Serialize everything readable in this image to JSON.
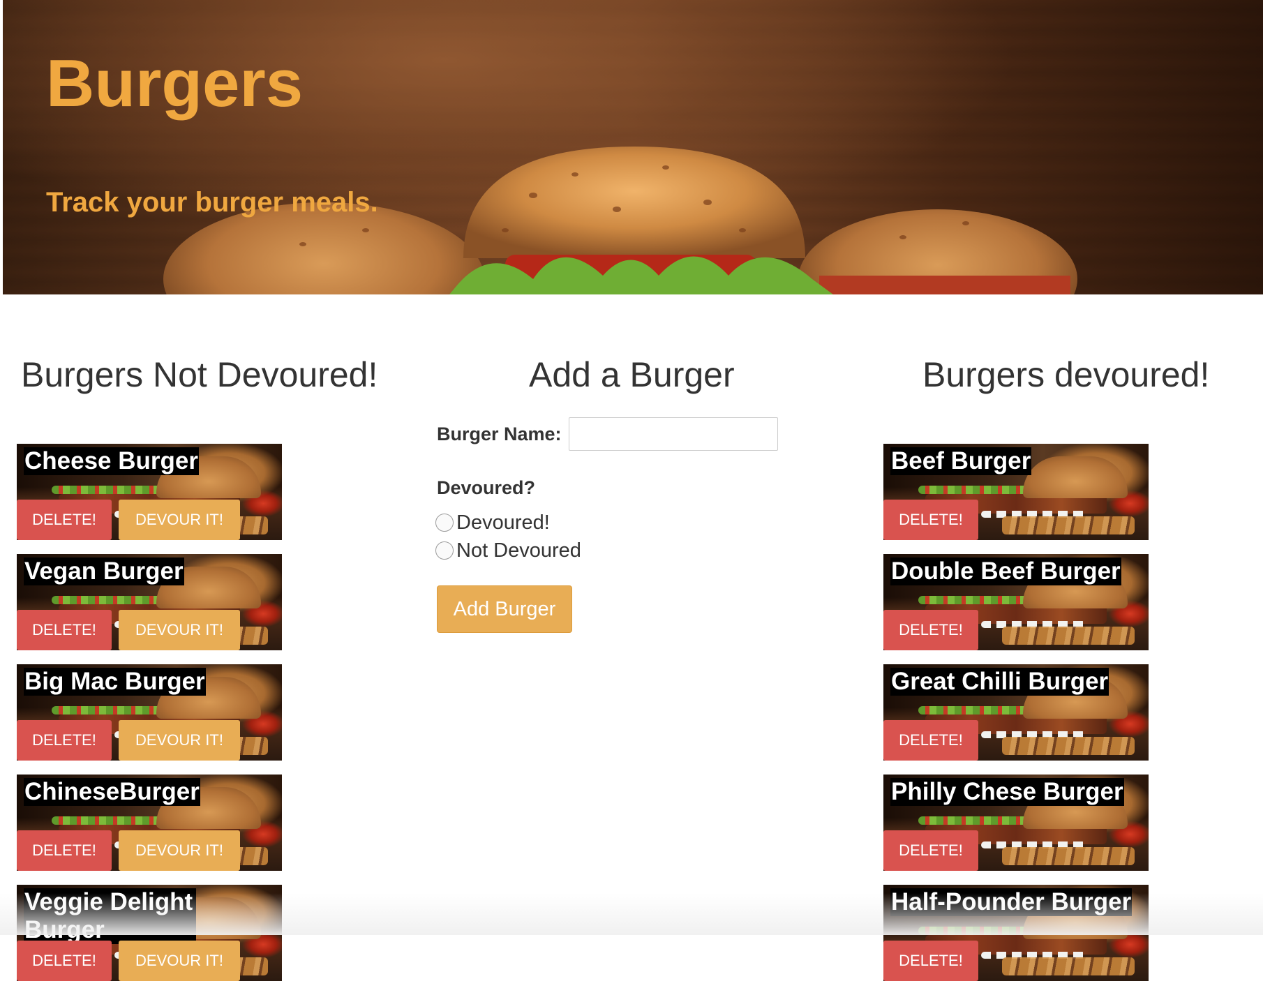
{
  "hero": {
    "title": "Burgers",
    "subtitle": "Track your burger meals."
  },
  "not_devoured": {
    "heading": "Burgers Not Devoured!",
    "items": [
      {
        "name": "Cheese Burger",
        "delete_label": "DELETE!",
        "devour_label": "DEVOUR IT!"
      },
      {
        "name": "Vegan Burger",
        "delete_label": "DELETE!",
        "devour_label": "DEVOUR IT!"
      },
      {
        "name": "Big Mac Burger",
        "delete_label": "DELETE!",
        "devour_label": "DEVOUR IT!"
      },
      {
        "name": "ChineseBurger",
        "delete_label": "DELETE!",
        "devour_label": "DEVOUR IT!"
      },
      {
        "name": "Veggie Delight Burger",
        "delete_label": "DELETE!",
        "devour_label": "DEVOUR IT!"
      }
    ]
  },
  "form": {
    "heading": "Add a Burger",
    "name_label": "Burger Name:",
    "name_value": "",
    "devoured_question": "Devoured?",
    "options": [
      {
        "label": "Devoured!",
        "checked": false
      },
      {
        "label": "Not Devoured",
        "checked": false
      }
    ],
    "submit_label": "Add Burger"
  },
  "devoured": {
    "heading": "Burgers devoured!",
    "items": [
      {
        "name": "Beef Burger",
        "delete_label": "DELETE!"
      },
      {
        "name": "Double Beef Burger",
        "delete_label": "DELETE!"
      },
      {
        "name": "Great Chilli Burger",
        "delete_label": "DELETE!"
      },
      {
        "name": "Philly Chese Burger",
        "delete_label": "DELETE!"
      },
      {
        "name": "Half-Pounder Burger",
        "delete_label": "DELETE!"
      }
    ]
  },
  "colors": {
    "accent": "#f0a840",
    "delete": "#d9534f",
    "devour": "#e8ad55"
  }
}
